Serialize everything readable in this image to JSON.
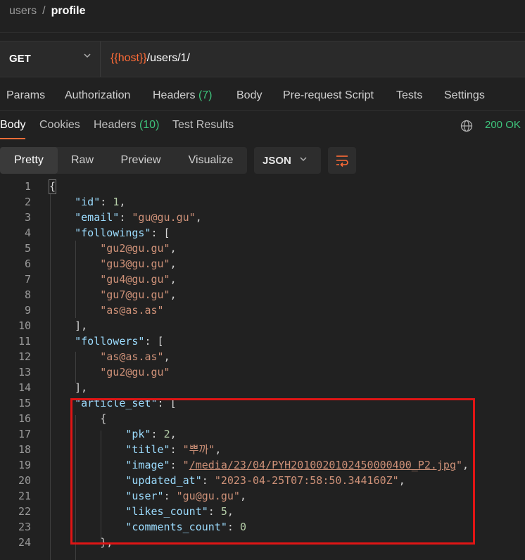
{
  "breadcrumb": {
    "parent": "users",
    "separator": "/",
    "current": "profile"
  },
  "request": {
    "method": "GET",
    "url_variable": "{{host}}",
    "url_path": "/users/1/"
  },
  "request_tabs": [
    {
      "label": "Params"
    },
    {
      "label": "Authorization"
    },
    {
      "label": "Headers",
      "count": "(7)"
    },
    {
      "label": "Body"
    },
    {
      "label": "Pre-request Script"
    },
    {
      "label": "Tests"
    },
    {
      "label": "Settings"
    }
  ],
  "response_tabs": [
    {
      "label": "Body",
      "active": true
    },
    {
      "label": "Cookies"
    },
    {
      "label": "Headers",
      "count": "(10)"
    },
    {
      "label": "Test Results"
    }
  ],
  "status": {
    "text": "200 OK",
    "color": "#3ec47c"
  },
  "view_modes": [
    {
      "label": "Pretty",
      "active": true
    },
    {
      "label": "Raw"
    },
    {
      "label": "Preview"
    },
    {
      "label": "Visualize"
    }
  ],
  "format": {
    "label": "JSON"
  },
  "icons": {
    "method_dropdown": "chevron-down-icon",
    "globe": "globe-icon",
    "format_dropdown": "chevron-down-icon",
    "wrap": "wrap-lines-icon"
  },
  "colors": {
    "accent": "#ff6c37",
    "highlight_box": "#e01515",
    "count": "#3ec47c"
  },
  "code_lines": [
    {
      "n": "1"
    },
    {
      "n": "2"
    },
    {
      "n": "3"
    },
    {
      "n": "4"
    },
    {
      "n": "5"
    },
    {
      "n": "6"
    },
    {
      "n": "7"
    },
    {
      "n": "8"
    },
    {
      "n": "9"
    },
    {
      "n": "10"
    },
    {
      "n": "11"
    },
    {
      "n": "12"
    },
    {
      "n": "13"
    },
    {
      "n": "14"
    },
    {
      "n": "15"
    },
    {
      "n": "16"
    },
    {
      "n": "17"
    },
    {
      "n": "18"
    },
    {
      "n": "19"
    },
    {
      "n": "20"
    },
    {
      "n": "21"
    },
    {
      "n": "22"
    },
    {
      "n": "23"
    },
    {
      "n": "24"
    }
  ],
  "json": {
    "id_key": "\"id\"",
    "id_val": "1",
    "email_key": "\"email\"",
    "email_val": "\"gu@gu.gu\"",
    "followings_key": "\"followings\"",
    "followings": [
      "\"gu2@gu.gu\"",
      "\"gu3@gu.gu\"",
      "\"gu4@gu.gu\"",
      "\"gu7@gu.gu\"",
      "\"as@as.as\""
    ],
    "followers_key": "\"followers\"",
    "followers": [
      "\"as@as.as\"",
      "\"gu2@gu.gu\""
    ],
    "article_set_key": "\"article_set\"",
    "pk_key": "\"pk\"",
    "pk_val": "2",
    "title_key": "\"title\"",
    "title_val": "\"뿌까\"",
    "image_key": "\"image\"",
    "image_val": "/media/23/04/PYH2010020102450000400_P2.jpg",
    "updated_key": "\"updated_at\"",
    "updated_val": "\"2023-04-25T07:58:50.344160Z\"",
    "user_key": "\"user\"",
    "user_val": "\"gu@gu.gu\"",
    "likes_key": "\"likes_count\"",
    "likes_val": "5",
    "comments_key": "\"comments_count\"",
    "comments_val": "0"
  }
}
